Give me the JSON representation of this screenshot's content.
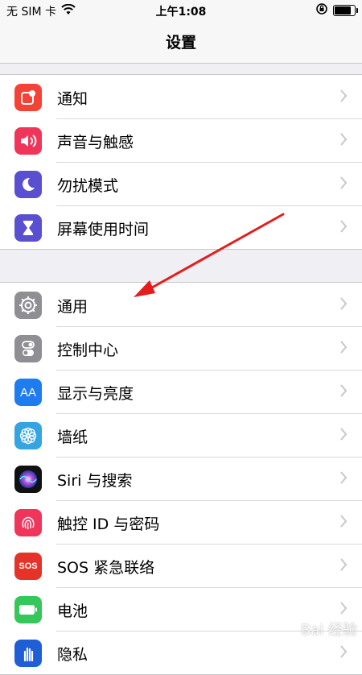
{
  "status_bar": {
    "carrier": "无 SIM 卡",
    "time": "上午1:08",
    "wifi_icon": "wifi-icon",
    "rotation_lock_icon": "rotation-lock-icon",
    "battery_level": 0.85
  },
  "nav": {
    "title": "设置"
  },
  "group1": {
    "items": [
      {
        "label": "通知",
        "icon": "notifications-icon",
        "color": "#f44336"
      },
      {
        "label": "声音与触感",
        "icon": "sound-icon",
        "color": "#f0355b"
      },
      {
        "label": "勿扰模式",
        "icon": "moon-icon",
        "color": "#5b4fd1"
      },
      {
        "label": "屏幕使用时间",
        "icon": "hourglass-icon",
        "color": "#5b4fd1"
      }
    ]
  },
  "group2": {
    "items": [
      {
        "label": "通用",
        "icon": "gear-icon",
        "color": "#8e8e93"
      },
      {
        "label": "控制中心",
        "icon": "toggle-icon",
        "color": "#8e8e93"
      },
      {
        "label": "显示与亮度",
        "icon": "text-size-icon",
        "color": "#1f7cf0"
      },
      {
        "label": "墙纸",
        "icon": "flower-icon",
        "color": "#35a4e0"
      },
      {
        "label": "Siri 与搜索",
        "icon": "siri-icon",
        "color": "#111111"
      },
      {
        "label": "触控 ID 与密码",
        "icon": "fingerprint-icon",
        "color": "#f0355b"
      },
      {
        "label": "SOS 紧急联络",
        "icon": "sos-icon",
        "color": "#e5332a"
      },
      {
        "label": "电池",
        "icon": "battery-icon",
        "color": "#34c759"
      },
      {
        "label": "隐私",
        "icon": "hand-icon",
        "color": "#1f5fd6"
      }
    ]
  },
  "icon_text": {
    "sos": "SOS",
    "text_size": "AA"
  },
  "watermark": "Bai 经验"
}
